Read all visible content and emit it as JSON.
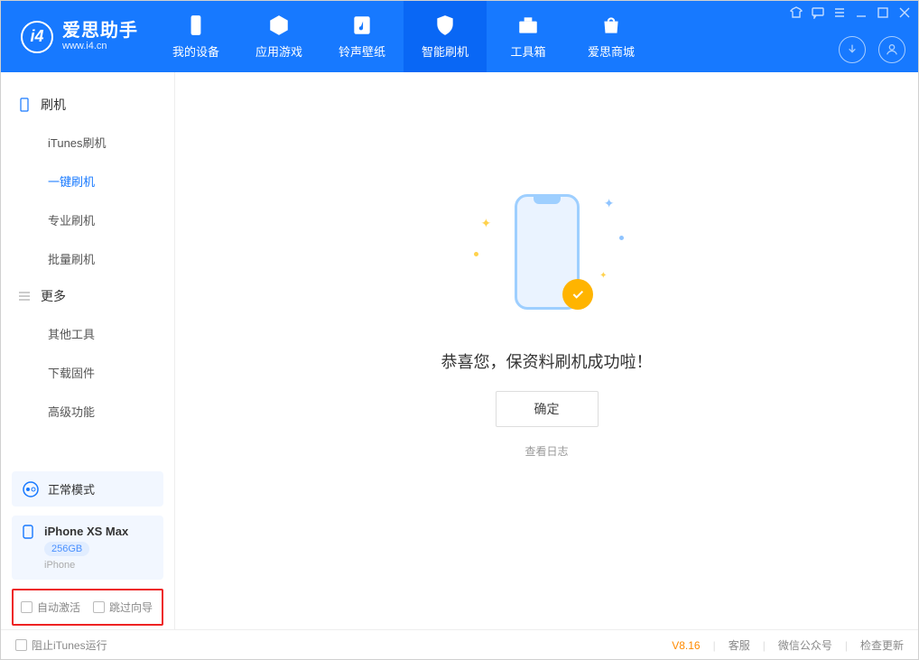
{
  "logo": {
    "name": "爱思助手",
    "url": "www.i4.cn"
  },
  "tabs": [
    {
      "label": "我的设备"
    },
    {
      "label": "应用游戏"
    },
    {
      "label": "铃声壁纸"
    },
    {
      "label": "智能刷机",
      "active": true
    },
    {
      "label": "工具箱"
    },
    {
      "label": "爱思商城"
    }
  ],
  "sidebar": {
    "group1": {
      "title": "刷机",
      "items": [
        "iTunes刷机",
        "一键刷机",
        "专业刷机",
        "批量刷机"
      ],
      "activeIndex": 1
    },
    "group2": {
      "title": "更多",
      "items": [
        "其他工具",
        "下载固件",
        "高级功能"
      ]
    }
  },
  "mode": {
    "label": "正常模式"
  },
  "device": {
    "name": "iPhone XS Max",
    "capacity": "256GB",
    "type": "iPhone"
  },
  "options": {
    "auto_activate": "自动激活",
    "skip_guide": "跳过向导"
  },
  "main": {
    "message": "恭喜您，保资料刷机成功啦！",
    "ok": "确定",
    "view_log": "查看日志"
  },
  "footer": {
    "block_itunes": "阻止iTunes运行",
    "version": "V8.16",
    "links": [
      "客服",
      "微信公众号",
      "检查更新"
    ]
  }
}
